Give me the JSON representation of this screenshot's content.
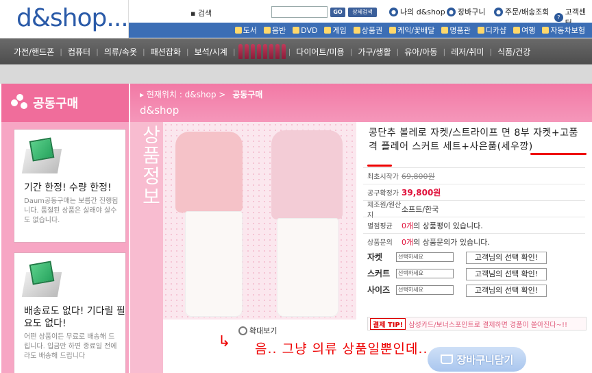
{
  "header": {
    "logo": "d&shop...",
    "search_label": "▪ 검색",
    "go_label": "GO",
    "advanced_search_label": "상세검색",
    "top_links": [
      "나의 d&shop",
      "장바구니",
      "주문/배송조회",
      "고객센터"
    ]
  },
  "categories": [
    "도서",
    "음반",
    "DVD",
    "게임",
    "상품권",
    "케익/꽃배달",
    "명품관",
    "디카샵",
    "여행",
    "자동차보험"
  ],
  "main_nav": [
    "가전/핸드폰",
    "컴퓨터",
    "의류/속옷",
    "패션잡화",
    "보석/시계",
    "화장품/향수",
    "다이어트/미용",
    "가구/생활",
    "유아/아동",
    "레저/취미",
    "식품/건강"
  ],
  "section": {
    "title": "공동구매",
    "breadcrumb_label": "▸ 현재위치 : d&shop",
    "breadcrumb_sep": ">",
    "breadcrumb_current": "공동구매",
    "shop_name": "d&shop"
  },
  "sidebar": {
    "cards": [
      {
        "title": "기간 한정! 수량 한정!",
        "desc": "Daum공동구매는 보름간 진행됩니다. 품절된 상품은 살래야 살수도 없습니다."
      },
      {
        "title": "배송료도 없다! 기다릴 필요도 없다!",
        "desc": "어떤 상품이든 무료로 배송해 드립니다. 입금만 하면 종료일 전에라도 배송해 드립니다"
      }
    ]
  },
  "product": {
    "vertical_label": "상품정보",
    "title": "콩단추 볼레로 자켓/스트라이프 면 8부 자켓+고품격 플레어 스커트 세트+사은품(세우깡)",
    "zoom_label": "확대보기",
    "rows": [
      {
        "label": "최초시작가",
        "value": "69,800원"
      },
      {
        "label": "공구확정가",
        "value": "39,800원"
      },
      {
        "label": "제조원/원산지",
        "value": "소프트/한국"
      },
      {
        "label": "별점평균",
        "prefix": "0개",
        "value": "의 상품평이 있습니다."
      },
      {
        "label": "상품문의",
        "prefix": "0개",
        "value": "의 상품문의가 있습니다."
      }
    ],
    "options": [
      {
        "label": "자켓",
        "select": "선택하세요",
        "button": "고객님의 선택 확인!"
      },
      {
        "label": "스커트",
        "select": "선택하세요",
        "button": "고객님의 선택 확인!"
      },
      {
        "label": "사이즈",
        "select": "선택하세요",
        "button": "고객님의 선택 확인!"
      }
    ],
    "tip_badge": "결제 TIP!",
    "tip_text": "삼성카드/보너스포인트로 결제하면 경품이 쏟아진다~!!",
    "cart_label": "장바구니담기"
  },
  "annotation": "음.. 그냥 의류 상품일뿐인데..",
  "colors": {
    "brand_blue": "#3c6eb5",
    "pink": "#f06d9b",
    "red": "#e0103a"
  }
}
